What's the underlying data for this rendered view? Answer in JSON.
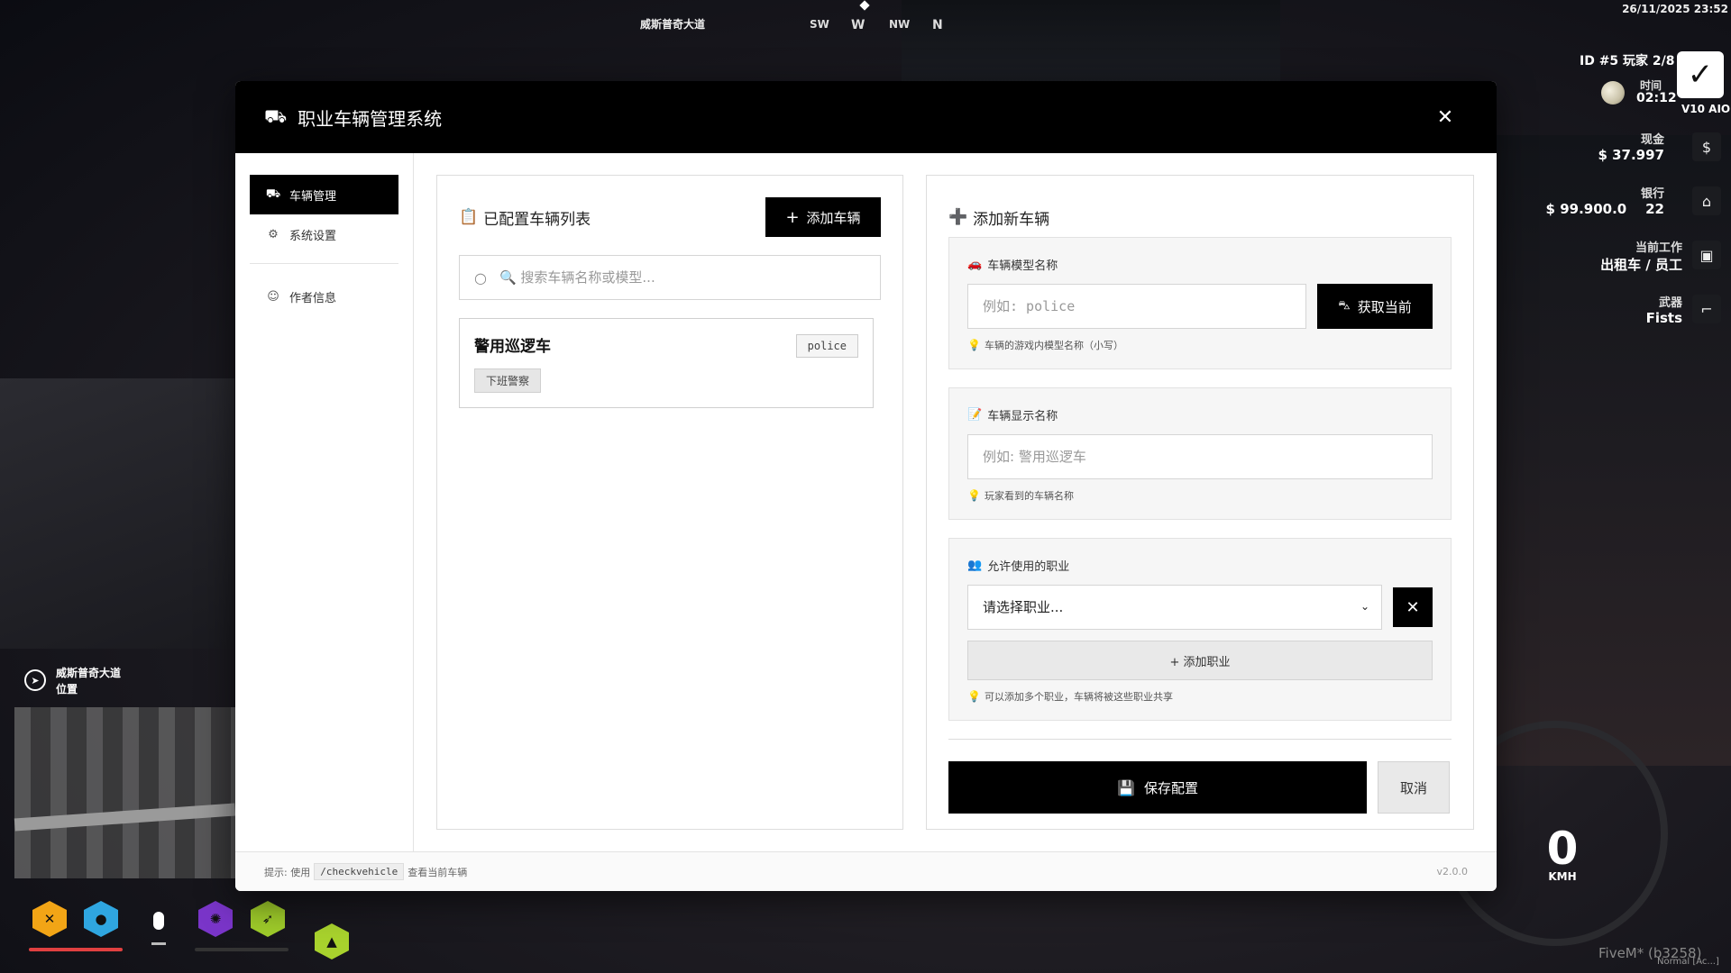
{
  "hud": {
    "street": "威斯普奇大道",
    "compass": [
      "SW",
      "W",
      "NW",
      "N"
    ],
    "datetime": "26/11/2025 23:52",
    "id_players": "ID #5  玩家 2/8",
    "time_label": "时间",
    "time_value": "02:12",
    "logo_label": "V10 AIO",
    "cash_label": "现金",
    "cash_value": "$ 37.997",
    "bank_label": "银行",
    "bank_value": "$ 99.900.0    22",
    "job_label": "当前工作",
    "job_value": "出租车 / 员工",
    "weapon_label": "武器",
    "weapon_value": "Fists",
    "location_street": "威斯普奇大道",
    "location_label": "位置",
    "speed": "0",
    "speed_unit": "KMH",
    "client": "FiveM* (b3258)",
    "mode": "Normal [Ac...]",
    "status_colors": {
      "hunger": "#f2a516",
      "thirst": "#2fa6e0",
      "stress": "#7a35c9",
      "stamina": "#9ecb2a",
      "extra": "#a8d22d",
      "health_bar": "#e04040"
    }
  },
  "modal": {
    "title": "职业车辆管理系统",
    "close_icon": "close-icon",
    "sidebar": [
      {
        "label": "车辆管理",
        "icon": "truck-icon",
        "active": true
      },
      {
        "label": "系统设置",
        "icon": "gear-icon",
        "active": false
      },
      {
        "label": "作者信息",
        "icon": "user-icon",
        "active": false
      }
    ],
    "list": {
      "title": "已配置车辆列表",
      "add_button": "添加车辆",
      "search_placeholder": "🔍 搜索车辆名称或模型...",
      "vehicles": [
        {
          "name": "警用巡逻车",
          "model": "police",
          "jobs": [
            "下班警察"
          ]
        }
      ]
    },
    "form": {
      "title": "添加新车辆",
      "model_label": "车辆模型名称",
      "model_placeholder": "例如: police",
      "get_current": "获取当前",
      "model_hint": "车辆的游戏内模型名称（小写）",
      "display_label": "车辆显示名称",
      "display_placeholder": "例如: 警用巡逻车",
      "display_hint": "玩家看到的车辆名称",
      "jobs_label": "允许使用的职业",
      "job_select": "请选择职业...",
      "add_job": "+ 添加职业",
      "jobs_hint": "可以添加多个职业，车辆将被这些职业共享",
      "save": "保存配置",
      "cancel": "取消"
    },
    "footer": {
      "hint_prefix": "提示: 使用",
      "command": "/checkvehicle",
      "hint_suffix": "查看当前车辆",
      "version": "v2.0.0"
    }
  }
}
